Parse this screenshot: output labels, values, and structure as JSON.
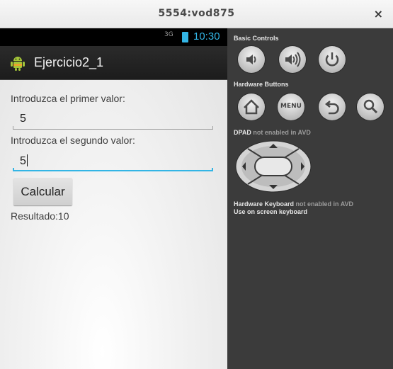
{
  "window": {
    "title": "5554:vod875",
    "close": "×"
  },
  "statusbar": {
    "signal": "3G",
    "time": "10:30"
  },
  "actionbar": {
    "title": "Ejercicio2_1",
    "icon": "android-robot-icon"
  },
  "form": {
    "label1": "Introduzca el primer valor:",
    "value1": "5",
    "label2": "Introduzca el segundo valor:",
    "value2": "5",
    "button": "Calcular",
    "result": "Resultado:10"
  },
  "controls": {
    "basic_title": "Basic Controls",
    "basic": [
      "volume-down-icon",
      "volume-up-icon",
      "power-icon"
    ],
    "hardware_title": "Hardware Buttons",
    "hardware": [
      "home-icon",
      "menu-button",
      "back-icon",
      "search-icon"
    ],
    "menu_label": "MENU",
    "dpad_title": "DPAD",
    "dpad_note": "not enabled in AVD",
    "keyboard_title": "Hardware Keyboard",
    "keyboard_note": "not enabled in AVD",
    "keyboard_hint": "Use on screen keyboard"
  },
  "colors": {
    "accent": "#33b5e5",
    "panel": "#3b3b3b",
    "actionbar": "#222222"
  }
}
